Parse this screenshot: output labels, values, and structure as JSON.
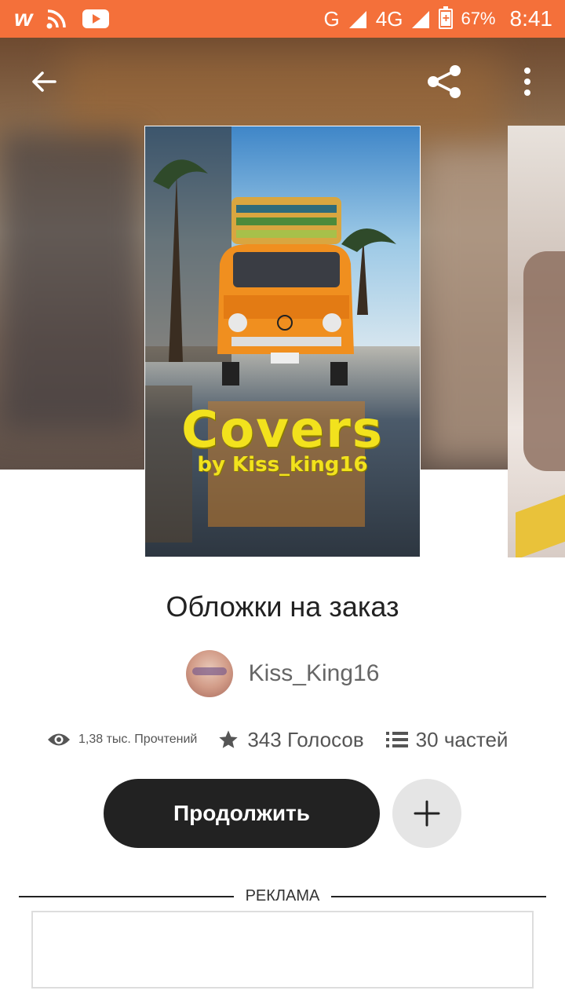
{
  "status_bar": {
    "network_label": "G",
    "network2_label": "4G",
    "network2_sup": "4G",
    "battery": "67%",
    "time": "8:41",
    "app_w": "w"
  },
  "book": {
    "cover_title": "Covers",
    "cover_subtitle": "by Kiss_king16",
    "title": "Обложки на заказ",
    "author": "Kiss_King16"
  },
  "stats": {
    "reads": "1,38 тыс. Прочтений",
    "votes": "343 Голосов",
    "parts": "30 частей"
  },
  "actions": {
    "continue_label": "Продолжить"
  },
  "ad": {
    "label": "РЕКЛАМА"
  },
  "colors": {
    "status_bar": "#f4703a",
    "button_dark": "#222222",
    "add_button": "#e5e5e5",
    "cover_text": "#f2e21d"
  }
}
